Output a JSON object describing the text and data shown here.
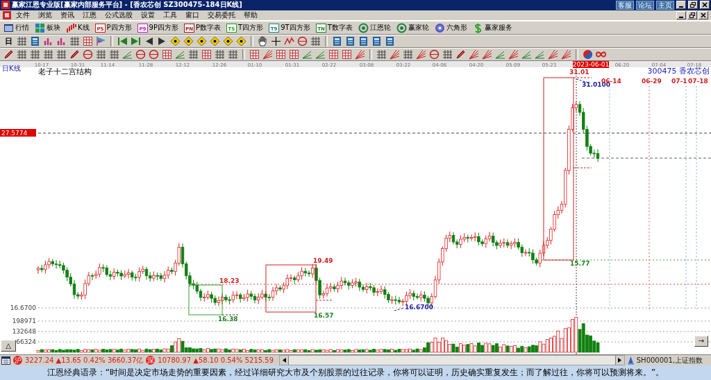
{
  "window": {
    "title": "赢家江恩专业版[赢家内部服务平台] - [香农芯创  SZ300475-184日K线]",
    "links": [
      "客服",
      "论坛",
      "主页"
    ]
  },
  "menu": [
    "文件",
    "浏览",
    "资讯",
    "江恩",
    "公式选股",
    "设置",
    "工具",
    "窗口",
    "交易委托",
    "帮助"
  ],
  "toolbar": [
    {
      "label": "行情",
      "kind": "screen"
    },
    {
      "label": "板块",
      "kind": "blocks"
    },
    {
      "label": "K线",
      "kind": "candles"
    },
    {
      "label": "P四方形",
      "kind": "badge",
      "badge": "PS",
      "color": "#c02020"
    },
    {
      "label": "9P四方形",
      "kind": "badge",
      "badge": "P9",
      "color": "#c020c0"
    },
    {
      "label": "P数字表",
      "kind": "badge",
      "badge": "PN",
      "color": "#a01818"
    },
    {
      "label": "T四方形",
      "kind": "badge",
      "badge": "TS",
      "color": "#20a020"
    },
    {
      "label": "9T四方形",
      "kind": "badge",
      "badge": "T9",
      "color": "#208080"
    },
    {
      "label": "T数字表",
      "kind": "badge",
      "badge": "TN",
      "color": "#208020"
    },
    {
      "label": "江恩轮",
      "kind": "ring"
    },
    {
      "label": "赢家轮",
      "kind": "ring"
    },
    {
      "label": "六角形",
      "kind": "target"
    },
    {
      "label": "赢家服务",
      "kind": "dollar"
    }
  ],
  "period_selector": "日",
  "chart": {
    "period_label": "日K线",
    "indicator_title": "老子十二宫结构",
    "stock_label": "300475 香农芯创",
    "date_axis": [
      {
        "label": "10-17",
        "selected": false
      },
      {
        "label": "10-31",
        "selected": false
      },
      {
        "label": "11-14",
        "selected": false
      },
      {
        "label": "11-28",
        "selected": false
      },
      {
        "label": "12-12",
        "selected": false
      },
      {
        "label": "12-26",
        "selected": false
      },
      {
        "label": "01-10",
        "selected": false
      },
      {
        "label": "01-31",
        "selected": false
      },
      {
        "label": "02-22",
        "selected": false
      },
      {
        "label": "03-08",
        "selected": false
      },
      {
        "label": "03-22",
        "selected": false
      },
      {
        "label": "04-06",
        "selected": false
      },
      {
        "label": "04-20",
        "selected": false
      },
      {
        "label": "05-09",
        "selected": false
      },
      {
        "label": "05-23",
        "selected": false
      },
      {
        "label": "2023-06-01",
        "selected": true
      },
      {
        "label": "06-20",
        "selected": false
      },
      {
        "label": "07-04",
        "selected": false
      },
      {
        "label": "07-18",
        "selected": false
      }
    ],
    "price_axis": [
      {
        "label": "27.5774",
        "highlighted": true
      },
      {
        "label": "16.6700",
        "highlighted": false
      }
    ],
    "volume_axis": [
      "198971",
      "132648",
      "66324"
    ],
    "annotations": [
      {
        "text": "31.01",
        "color": "#d02020"
      },
      {
        "text": "31.0100",
        "color": "#2020a0"
      },
      {
        "text": "06-14",
        "color": "#d02020"
      },
      {
        "text": "06-29",
        "color": "#d02020"
      },
      {
        "text": "07-1",
        "color": "#d02020"
      },
      {
        "text": "07-18",
        "color": "#d02020"
      },
      {
        "text": "18.23",
        "color": "#d02020"
      },
      {
        "text": "16.38",
        "color": "#208020"
      },
      {
        "text": "19.49",
        "color": "#d02020"
      },
      {
        "text": "16.57",
        "color": "#208020"
      },
      {
        "text": "16.6700",
        "color": "#2020a0"
      },
      {
        "text": "15.77",
        "color": "#208020"
      }
    ],
    "left_button": "△",
    "right_button": "→"
  },
  "status_bar": {
    "indices": [
      {
        "badge": "沪",
        "text": "3227.24 ▲13.65 0.42% 3660.37亿"
      },
      {
        "badge": "深",
        "text": "10780.97 ▲58.10 0.54% 5215.59"
      }
    ],
    "index_code": "SH000001,上证指数"
  },
  "quote": "江恩经典语录：“时间是决定市场走势的重要因素，经过详细研究大市及个别股票的过往记录，你将可以证明，历史确实重复发生；而了解过往，你将可以预测将来。”。"
}
